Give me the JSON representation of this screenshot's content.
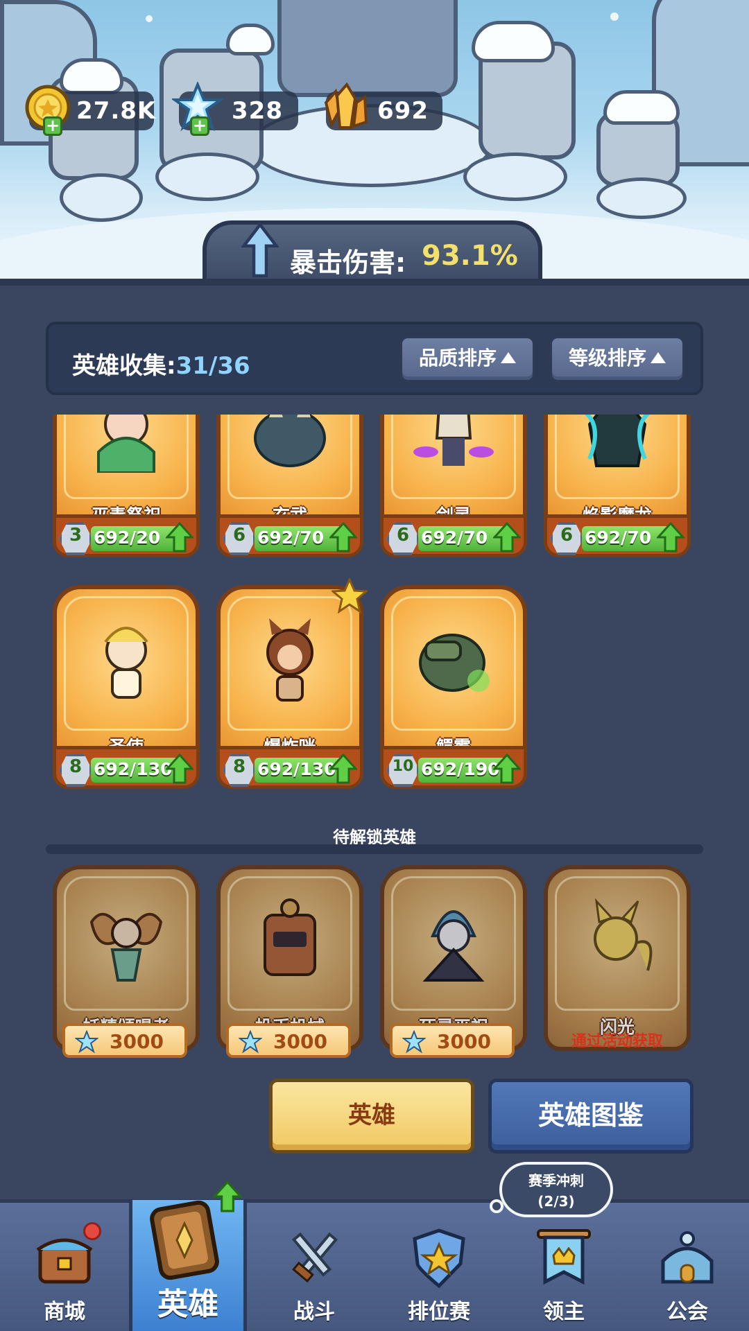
{
  "currencies": [
    {
      "icon": "gold-coin-icon",
      "value": "27.8K"
    },
    {
      "icon": "ice-crystal-icon",
      "value": "328"
    },
    {
      "icon": "gold-crystal-icon",
      "value": "692"
    }
  ],
  "stat_banner": {
    "label": "暴击伤害:",
    "value": "93.1%"
  },
  "collection": {
    "label": "英雄收集:",
    "count": "31/36"
  },
  "sort_buttons": {
    "quality": "品质排序",
    "level": "等级排序"
  },
  "owned_heroes": [
    {
      "name": "巫毒祭祀",
      "level": "3",
      "progress_text": "692/20",
      "progress_fraction": 1.0
    },
    {
      "name": "玄武",
      "level": "6",
      "progress_text": "692/70",
      "progress_fraction": 1.0
    },
    {
      "name": "剑灵",
      "level": "6",
      "progress_text": "692/70",
      "progress_fraction": 1.0
    },
    {
      "name": "焰影魔龙",
      "level": "6",
      "progress_text": "692/70",
      "progress_fraction": 1.0
    },
    {
      "name": "圣使",
      "level": "8",
      "progress_text": "692/130",
      "progress_fraction": 1.0
    },
    {
      "name": "爆炸咪",
      "level": "8",
      "progress_text": "692/130",
      "progress_fraction": 1.0
    },
    {
      "name": "鳄霸",
      "level": "10",
      "progress_text": "692/190",
      "progress_fraction": 1.0
    }
  ],
  "locked_section_label": "待解锁英雄",
  "locked_heroes": [
    {
      "name": "妖精颂唱者",
      "cost": "3000"
    },
    {
      "name": "投币机械",
      "cost": "3000"
    },
    {
      "name": "死灵巫祝",
      "cost": "3000"
    },
    {
      "name": "闪光",
      "note": "通过活动获取"
    }
  ],
  "actions": {
    "hero": "英雄",
    "codex": "英雄图鉴"
  },
  "season_bubble": {
    "title": "赛季冲刺",
    "progress": "(2/3)"
  },
  "nav": [
    {
      "label": "商城",
      "icon": "shop-chest-icon"
    },
    {
      "label": "英雄",
      "icon": "hero-card-icon",
      "active": true
    },
    {
      "label": "战斗",
      "icon": "crossed-swords-icon"
    },
    {
      "label": "排位赛",
      "icon": "rank-shield-icon"
    },
    {
      "label": "领主",
      "icon": "lord-banner-icon"
    },
    {
      "label": "公会",
      "icon": "guild-hall-icon"
    }
  ],
  "colors": {
    "accent_gold": "#f3e16c",
    "collection_count": "#8fd3ff",
    "card_orange": "#f7b24a",
    "progress_green": "#4fb33b",
    "nav_active": "#3b7fd0"
  }
}
